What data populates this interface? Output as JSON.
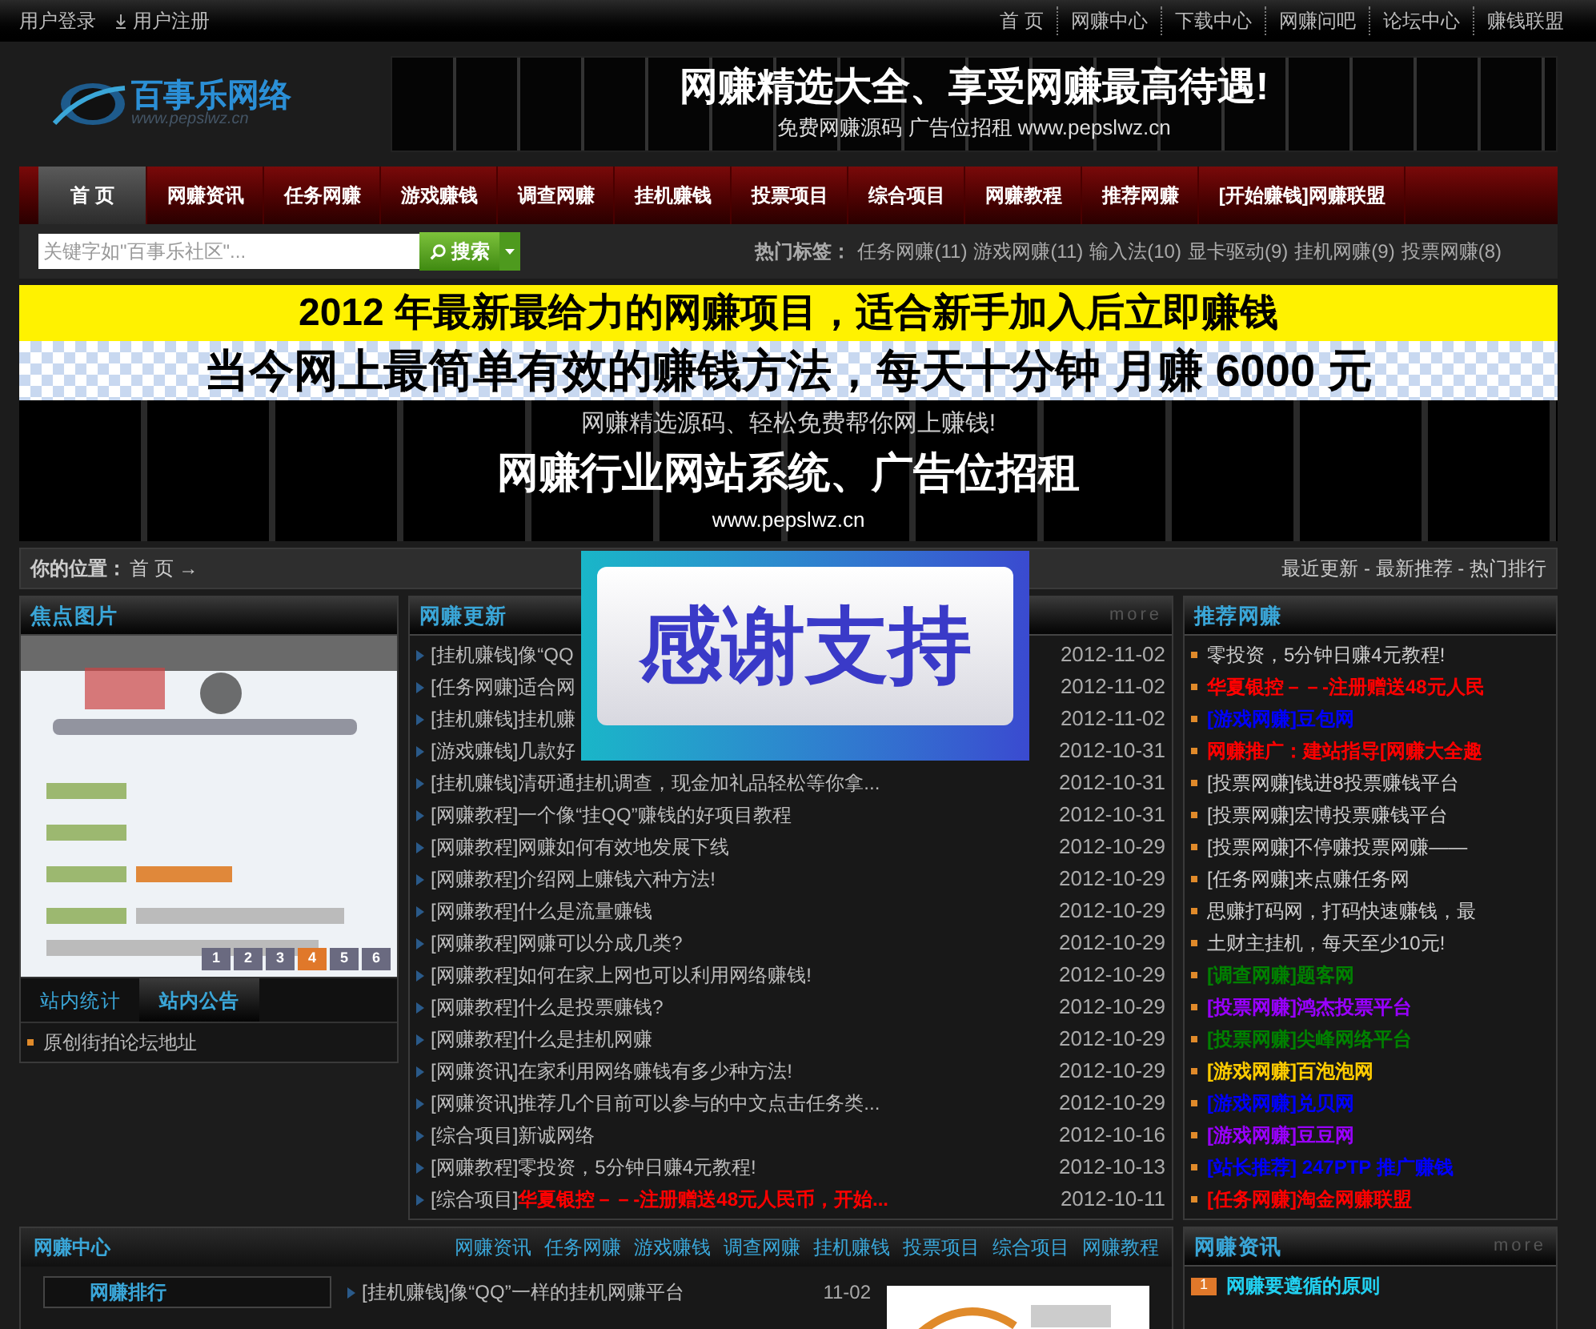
{
  "top_bar": {
    "left_links": [
      "用户登录",
      "用户注册"
    ],
    "right_links": [
      "首 页",
      "网赚中心",
      "下载中心",
      "网赚问吧",
      "论坛中心",
      "赚钱联盟"
    ]
  },
  "header": {
    "logo_text": "百事乐网络",
    "logo_url": "www.pepslwz.cn",
    "banner_title": "网赚精选大全、享受网赚最高待遇!",
    "banner_sub": "免费网赚源码  广告位招租  www.pepslwz.cn"
  },
  "nav": [
    {
      "label": "首 页",
      "selected": true
    },
    {
      "label": "网赚资讯",
      "selected": false
    },
    {
      "label": "任务网赚",
      "selected": false
    },
    {
      "label": "游戏赚钱",
      "selected": false
    },
    {
      "label": "调查网赚",
      "selected": false
    },
    {
      "label": "挂机赚钱",
      "selected": false
    },
    {
      "label": "投票项目",
      "selected": false
    },
    {
      "label": "综合项目",
      "selected": false
    },
    {
      "label": "网赚教程",
      "selected": false
    },
    {
      "label": "推荐网赚",
      "selected": false
    },
    {
      "label": "[开始赚钱]网赚联盟",
      "selected": false
    }
  ],
  "search": {
    "placeholder": "关键字如\"百事乐社区\"...",
    "button": "搜索",
    "hot_label": "热门标签：",
    "hot_tags": [
      "任务网赚(11)",
      "游戏网赚(11)",
      "输入法(10)",
      "显卡驱动(9)",
      "挂机网赚(9)",
      "投票网赚(8)"
    ]
  },
  "promo": {
    "line1": "2012 年最新最给力的网赚项目，适合新手加入后立即赚钱",
    "line2": "当今网上最简单有效的赚钱方法，每天十分钟 月赚 6000 元",
    "sub1": "网赚精选源码、轻松免费帮你网上赚钱!",
    "sub2": "网赚行业网站系统、广告位招租",
    "sub3": "www.pepslwz.cn"
  },
  "location": {
    "label": "你的位置：",
    "path": "首 页 →",
    "right": "最近更新 - 最新推荐 - 热门排行"
  },
  "popup": {
    "text": "感谢支持"
  },
  "focus": {
    "title": "焦点图片",
    "pages": [
      {
        "label": "1",
        "selected": false
      },
      {
        "label": "2",
        "selected": false
      },
      {
        "label": "3",
        "selected": false
      },
      {
        "label": "4",
        "selected": true
      },
      {
        "label": "5",
        "selected": false
      },
      {
        "label": "6",
        "selected": false
      }
    ],
    "tabs": [
      {
        "label": "站内统计",
        "selected": false
      },
      {
        "label": "站内公告",
        "selected": true
      }
    ],
    "notices": [
      "原创街拍论坛地址"
    ]
  },
  "updates": {
    "title": "网赚更新",
    "more": "more",
    "rows": [
      {
        "category": "[挂机赚钱]",
        "title": "像“QQ",
        "date": "2012-11-02"
      },
      {
        "category": "[任务网赚]",
        "title": "适合网",
        "date": "2012-11-02"
      },
      {
        "category": "[挂机赚钱]",
        "title": "挂机赚",
        "date": "2012-11-02"
      },
      {
        "category": "[游戏赚钱]",
        "title": "几款好",
        "date": "2012-10-31"
      },
      {
        "category": "[挂机赚钱]",
        "title": "清研通挂机调查，现金加礼品轻松等你拿...",
        "date": "2012-10-31"
      },
      {
        "category": "[网赚教程]",
        "title": "一个像“挂QQ”赚钱的好项目教程",
        "date": "2012-10-31"
      },
      {
        "category": "[网赚教程]",
        "title": "网赚如何有效地发展下线",
        "date": "2012-10-29"
      },
      {
        "category": "[网赚教程]",
        "title": "介绍网上赚钱六种方法!",
        "date": "2012-10-29"
      },
      {
        "category": "[网赚教程]",
        "title": "什么是流量赚钱",
        "date": "2012-10-29"
      },
      {
        "category": "[网赚教程]",
        "title": "网赚可以分成几类?",
        "date": "2012-10-29"
      },
      {
        "category": "[网赚教程]",
        "title": "如何在家上网也可以利用网络赚钱!",
        "date": "2012-10-29"
      },
      {
        "category": "[网赚教程]",
        "title": "什么是投票赚钱?",
        "date": "2012-10-29"
      },
      {
        "category": "[网赚教程]",
        "title": "什么是挂机网赚",
        "date": "2012-10-29"
      },
      {
        "category": "[网赚资讯]",
        "title": "在家利用网络赚钱有多少种方法!",
        "date": "2012-10-29"
      },
      {
        "category": "[网赚资讯]",
        "title": "推荐几个目前可以参与的中文点击任务类...",
        "date": "2012-10-29"
      },
      {
        "category": "[综合项目]",
        "title": "新诚网络",
        "date": "2012-10-16"
      },
      {
        "category": "[网赚教程]",
        "title": "零投资，5分钟日赚4元教程!",
        "date": "2012-10-13"
      },
      {
        "category": "[综合项目]",
        "title": "华夏银控－－-注册赠送48元人民币，开始...",
        "date": "2012-10-11",
        "color": "#ff0000"
      }
    ]
  },
  "recommend": {
    "title": "推荐网赚",
    "items": [
      {
        "text": "零投资，5分钟日赚4元教程!",
        "color": "#cccccc",
        "bold": false
      },
      {
        "text": "华夏银控－－-注册赠送48元人民",
        "color": "#ff0000",
        "bold": true
      },
      {
        "text": "[游戏网赚]豆包网",
        "color": "#0000ff",
        "bold": true
      },
      {
        "text": "网赚推广：建站指导[网赚大全趣",
        "color": "#ff0000",
        "bold": true
      },
      {
        "text": "[投票网赚]钱进8投票赚钱平台",
        "color": "#cccccc",
        "bold": false
      },
      {
        "text": "[投票网赚]宏博投票赚钱平台",
        "color": "#cccccc",
        "bold": false
      },
      {
        "text": "[投票网赚]不停赚投票网赚——",
        "color": "#cccccc",
        "bold": false
      },
      {
        "text": "[任务网赚]来点赚任务网",
        "color": "#cccccc",
        "bold": false
      },
      {
        "text": "思赚打码网，打码快速赚钱，最",
        "color": "#cccccc",
        "bold": false
      },
      {
        "text": "土财主挂机，每天至少10元!",
        "color": "#cccccc",
        "bold": false
      },
      {
        "text": "[调查网赚]题客网",
        "color": "#008000",
        "bold": true
      },
      {
        "text": "[投票网赚]鸿杰投票平台",
        "color": "#9900ff",
        "bold": true
      },
      {
        "text": "[投票网赚]尖峰网络平台",
        "color": "#008000",
        "bold": true
      },
      {
        "text": "[游戏网赚]百泡泡网",
        "color": "#ffcc00",
        "bold": true
      },
      {
        "text": "[游戏网赚]兑贝网",
        "color": "#0000ff",
        "bold": true
      },
      {
        "text": "[游戏网赚]豆豆网",
        "color": "#9900ff",
        "bold": true
      },
      {
        "text": "[站长推荐] 247PTP 推广赚钱",
        "color": "#0000ff",
        "bold": true
      },
      {
        "text": "[任务网赚]淘金网赚联盟",
        "color": "#ff0000",
        "bold": true
      }
    ]
  },
  "center": {
    "title": "网赚中心",
    "links": [
      "网赚资讯",
      "任务网赚",
      "游戏赚钱",
      "调查网赚",
      "挂机赚钱",
      "投票项目",
      "综合项目",
      "网赚教程"
    ],
    "tab": "网赚排行",
    "rows": [
      {
        "title": "[挂机赚钱]像“QQ”一样的挂机网赚平台",
        "date": "11-02"
      }
    ]
  },
  "news": {
    "title": "网赚资讯",
    "more": "more",
    "items": [
      {
        "rank": "1",
        "title": "网赚要遵循的原则"
      }
    ]
  }
}
